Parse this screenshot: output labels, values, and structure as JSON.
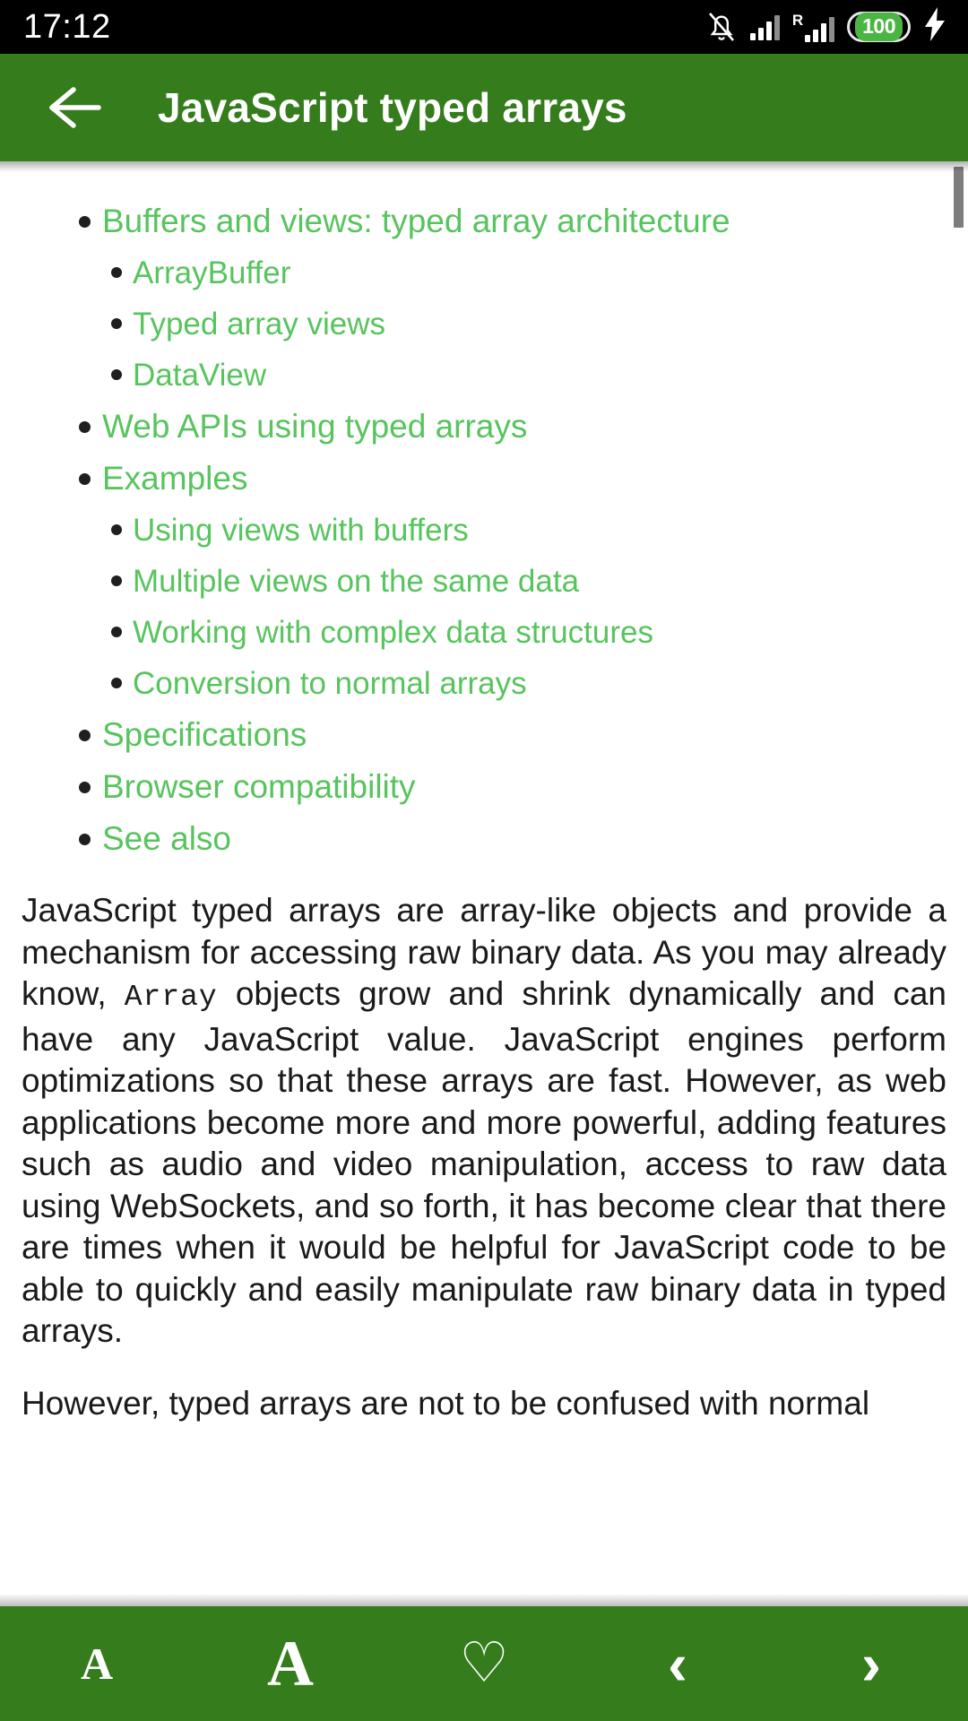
{
  "status_bar": {
    "time": "17:12",
    "battery_percent": "100",
    "icons": {
      "notifications_muted": "bell-muted-icon",
      "signal_1": "signal-bars-icon",
      "roaming": "R",
      "signal_2": "signal-bars-roaming-icon",
      "battery": "battery-icon",
      "charging": "charging-bolt-icon"
    }
  },
  "app_bar": {
    "back_label": "←",
    "title": "JavaScript typed arrays"
  },
  "colors": {
    "header_green": "#357c1c",
    "link_green": "#58c45e",
    "status_bar_black": "#000000",
    "battery_green": "#4bb543",
    "body_text": "#1a1a1a"
  },
  "toc": [
    {
      "label": "Buffers and views: typed array architecture",
      "children": [
        {
          "label": "ArrayBuffer"
        },
        {
          "label": "Typed array views"
        },
        {
          "label": "DataView"
        }
      ]
    },
    {
      "label": "Web APIs using typed arrays",
      "children": []
    },
    {
      "label": "Examples",
      "children": [
        {
          "label": "Using views with buffers"
        },
        {
          "label": "Multiple views on the same data"
        },
        {
          "label": "Working with complex data structures"
        },
        {
          "label": "Conversion to normal arrays"
        }
      ]
    },
    {
      "label": "Specifications",
      "children": []
    },
    {
      "label": "Browser compatibility",
      "children": []
    },
    {
      "label": "See also",
      "children": []
    }
  ],
  "article": {
    "paragraph_1_part_1": "JavaScript typed arrays are array-like objects and provide a mechanism for accessing raw binary data. As you may already know, ",
    "paragraph_1_code": "Array",
    "paragraph_1_part_2": " objects grow and shrink dynamically and can have any JavaScript value. JavaScript engines perform optimizations so that these arrays are fast. However, as web applications become more and more powerful, adding features such as audio and video manipulation, access to raw data using WebSockets, and so forth, it has become clear that there are times when it would be helpful for JavaScript code to be able to quickly and easily manipulate raw binary data in typed arrays.",
    "paragraph_2": "However, typed arrays are not to be confused with normal"
  },
  "bottom_toolbar": {
    "decrease_font_label": "A",
    "increase_font_label": "A",
    "favorite_label": "♡",
    "previous_label": "‹",
    "next_label": "›"
  }
}
